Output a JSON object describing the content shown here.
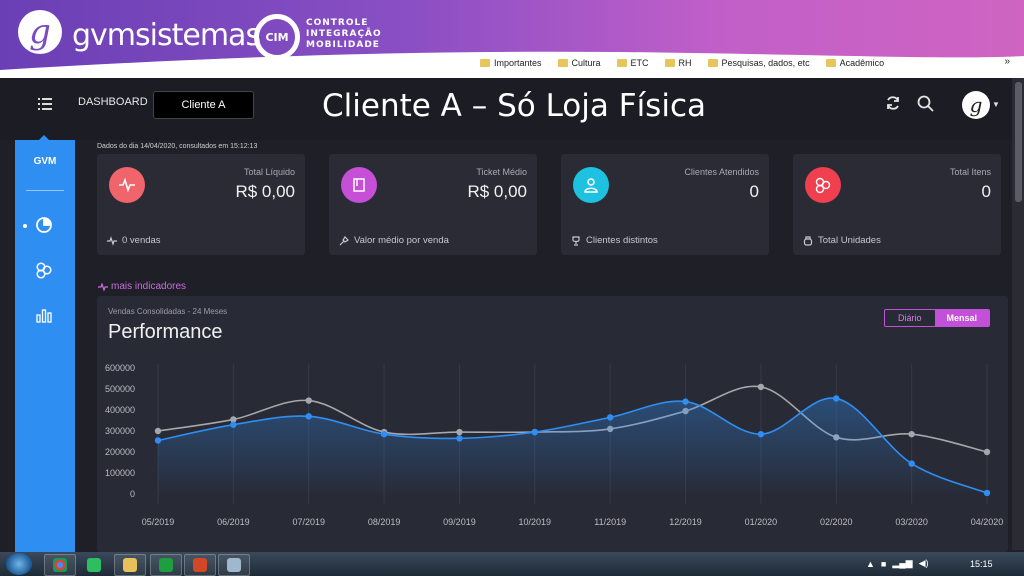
{
  "browser": {
    "logo_text": "gvmsistemas",
    "logo_letter": "g",
    "partner_logo": "CIM",
    "partner_text": [
      "CONTROLE",
      "INTEGRAÇÃO",
      "MOBILIDADE"
    ],
    "bookmarks": [
      "Importantes",
      "Cultura",
      "ETC",
      "RH",
      "Pesquisas, dados, etc",
      "Acadêmico"
    ],
    "more_bookmarks": "»"
  },
  "header": {
    "dashboard_label": "DASHBOARD",
    "client_selector": "Cliente A",
    "page_heading": "Cliente A – Só Loja Física",
    "avatar_letter": "g"
  },
  "sidebar": {
    "brand": "GVM",
    "icons": [
      "pie-chart-icon",
      "hexagons-icon",
      "bar-chart-icon"
    ]
  },
  "date_info": "Dados do dia 14/04/2020, consultados em 15:12:13",
  "cards": [
    {
      "title": "Total Líquido",
      "value": "R$ 0,00",
      "footer": "0 vendas",
      "color": "#f0646c",
      "icon": "pulse-icon",
      "footer_icon": "pulse-small-icon"
    },
    {
      "title": "Ticket Médio",
      "value": "R$ 0,00",
      "footer": "Valor médio por venda",
      "color": "#c54fd6",
      "icon": "book-icon",
      "footer_icon": "pin-icon"
    },
    {
      "title": "Clientes Atendidos",
      "value": "0",
      "footer": "Clientes distintos",
      "color": "#1ec1e0",
      "icon": "user-icon",
      "footer_icon": "trophy-icon"
    },
    {
      "title": "Total Itens",
      "value": "0",
      "footer": "Total Unidades",
      "color": "#f0404f",
      "icon": "hexagons-icon",
      "footer_icon": "box-icon"
    }
  ],
  "more_indicators": "mais indicadores",
  "performance": {
    "subtitle": "Vendas Consolidadas - 24 Meses",
    "title": "Performance",
    "toggle": {
      "diario": "Diário",
      "mensal": "Mensal",
      "active": "mensal"
    }
  },
  "chart_data": {
    "type": "line",
    "categories": [
      "05/2019",
      "06/2019",
      "07/2019",
      "08/2019",
      "09/2019",
      "10/2019",
      "11/2019",
      "12/2019",
      "01/2020",
      "02/2020",
      "03/2020",
      "04/2020"
    ],
    "series": [
      {
        "color": "#2f8ef2",
        "values": [
          255000,
          330000,
          370000,
          285000,
          265000,
          295000,
          365000,
          440000,
          285000,
          455000,
          145000,
          5000
        ]
      },
      {
        "color": "#a6a6ad",
        "values": [
          300000,
          355000,
          445000,
          295000,
          295000,
          295000,
          310000,
          395000,
          510000,
          270000,
          285000,
          200000
        ]
      }
    ],
    "ylim": [
      0,
      600000
    ],
    "yticks": [
      "600000",
      "500000",
      "400000",
      "300000",
      "200000",
      "100000",
      "0"
    ],
    "ytick_values": [
      600000,
      500000,
      400000,
      300000,
      200000,
      100000,
      0
    ],
    "area_fill": true,
    "grid": "vertical"
  },
  "taskbar": {
    "clock": "15:15"
  }
}
